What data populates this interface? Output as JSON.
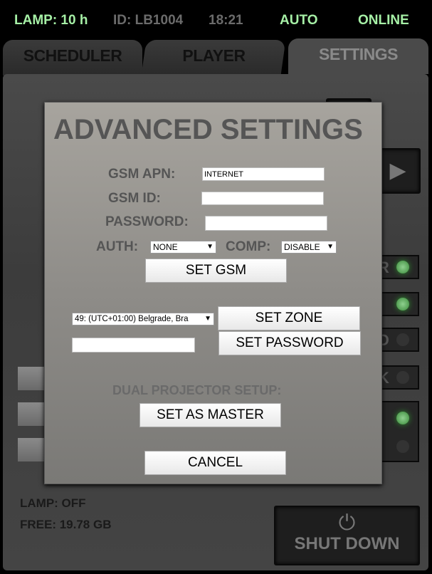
{
  "status": {
    "lamp": "LAMP: 10 h",
    "id": "ID: LB1004",
    "time": "18:21",
    "mode": "AUTO",
    "connection": "ONLINE"
  },
  "tabs": [
    {
      "label": "SCHEDULER"
    },
    {
      "label": "PLAYER"
    },
    {
      "label": "SETTINGS",
      "active": true
    }
  ],
  "background": {
    "indicators": [
      {
        "letter": "R",
        "led": "on"
      },
      {
        "letter": "",
        "led": "on"
      },
      {
        "letter": "D",
        "led": "off"
      },
      {
        "letter": "K",
        "led": "off"
      }
    ],
    "lamp": "LAMP: OFF",
    "free": "FREE: 19.78 GB",
    "shutdown": "SHUT DOWN"
  },
  "dialog": {
    "title": "ADVANCED SETTINGS",
    "gsm_apn_label": "GSM APN:",
    "gsm_apn_value": "INTERNET",
    "gsm_id_label": "GSM ID:",
    "gsm_id_value": "",
    "password_label": "PASSWORD:",
    "password_value": "",
    "auth_label": "AUTH:",
    "auth_value": "NONE",
    "comp_label": "COMP:",
    "comp_value": "DISABLE",
    "set_gsm": "SET GSM",
    "zone_value": "49: (UTC+01:00) Belgrade, Bra",
    "set_zone": "SET ZONE",
    "admin_password_value": "",
    "set_password": "SET PASSWORD",
    "dual_label": "DUAL PROJECTOR SETUP:",
    "set_master": "SET AS MASTER",
    "cancel": "CANCEL"
  },
  "colors": {
    "status_green": "#a6f0a6",
    "led_on": "#5fbf5f"
  }
}
